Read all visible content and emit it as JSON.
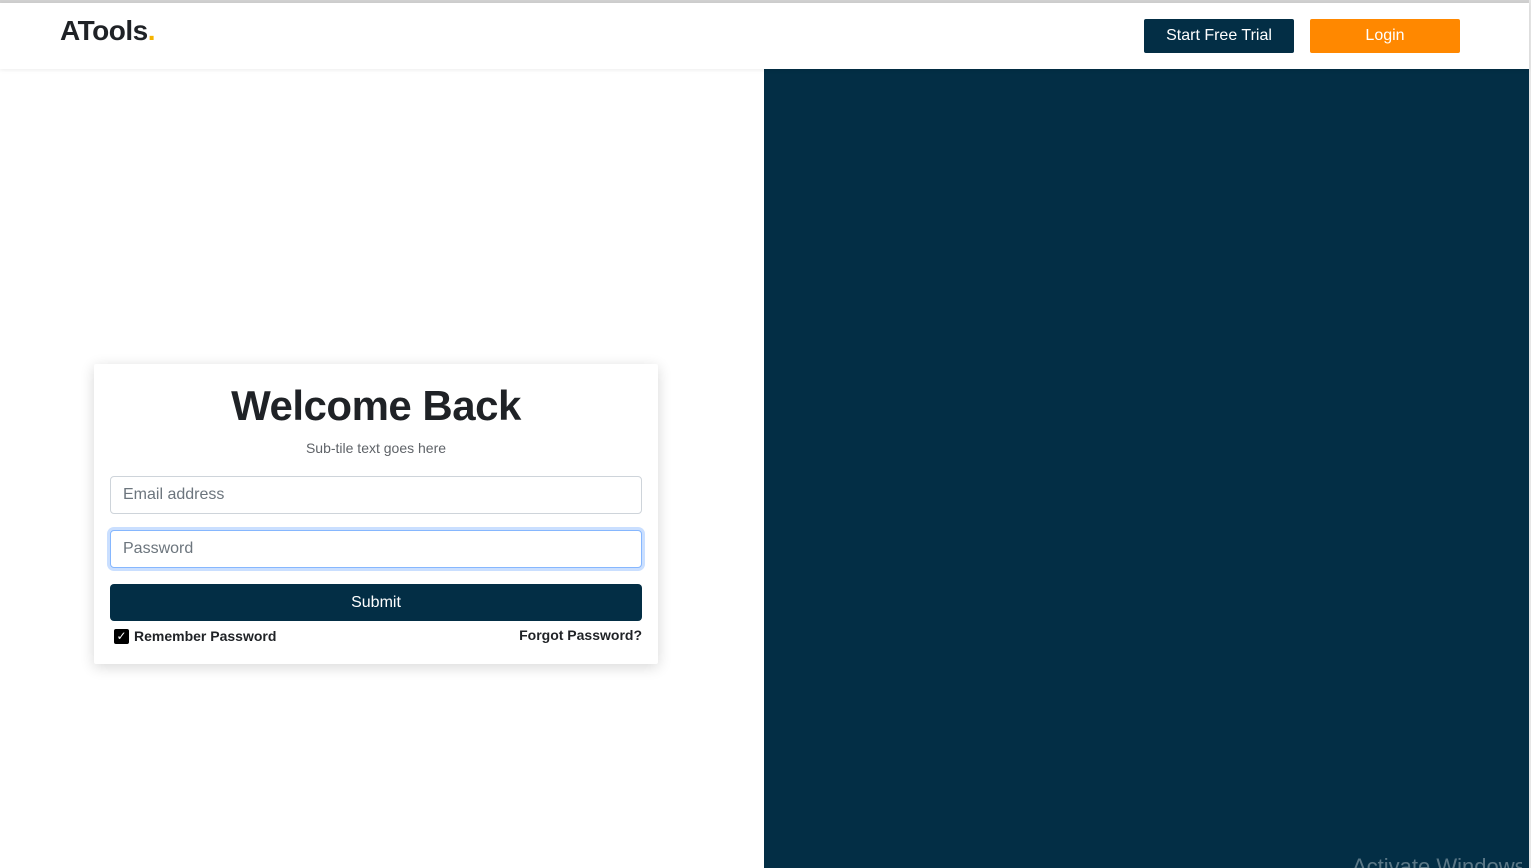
{
  "header": {
    "logo_text": "ATools",
    "logo_dot": ".",
    "start_trial_label": "Start Free Trial",
    "login_label": "Login"
  },
  "login_card": {
    "title": "Welcome Back",
    "subtitle": "Sub-tile text goes here",
    "email_placeholder": "Email address",
    "password_placeholder": "Password",
    "submit_label": "Submit",
    "remember_label": "Remember Password",
    "remember_checked": true,
    "forgot_label": "Forgot Password?"
  },
  "watermark": {
    "text": "Activate Windows"
  },
  "colors": {
    "brand_navy": "#032e45",
    "brand_orange": "#ff8800",
    "logo_dot": "#f5b400"
  }
}
